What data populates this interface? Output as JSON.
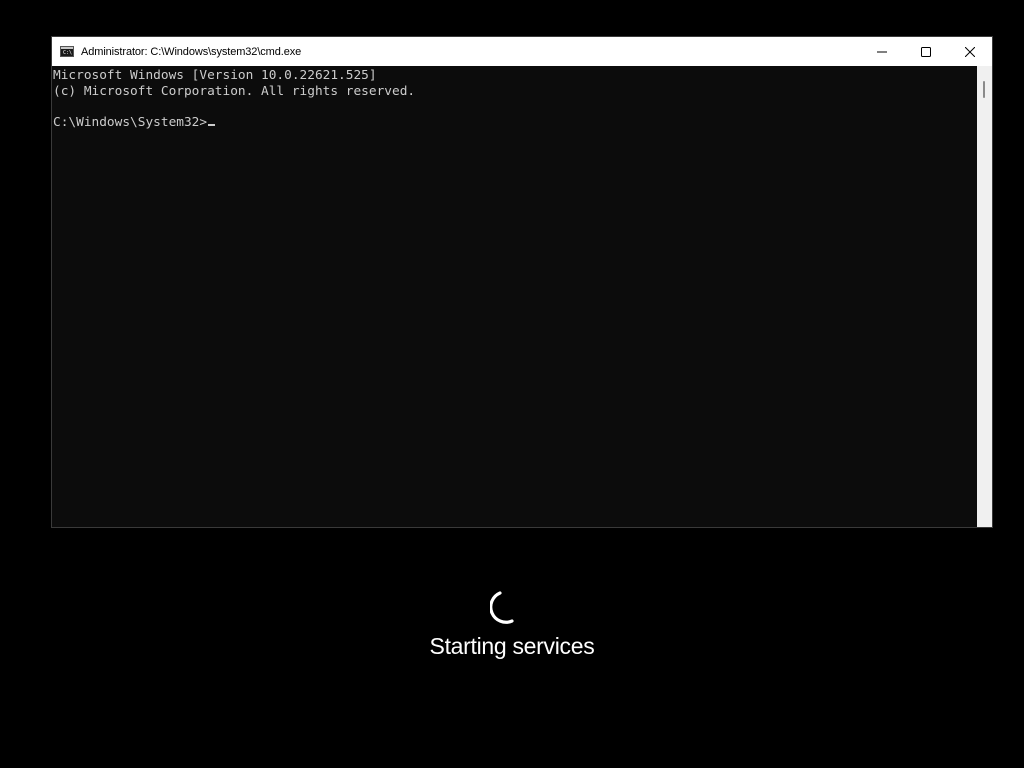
{
  "window": {
    "title": "Administrator: C:\\Windows\\system32\\cmd.exe",
    "icon": "cmd-icon"
  },
  "caption_buttons": {
    "minimize": "minimize-icon",
    "maximize": "maximize-icon",
    "close": "close-icon"
  },
  "console": {
    "lines": [
      "Microsoft Windows [Version 10.0.22621.525]",
      "(c) Microsoft Corporation. All rights reserved.",
      "",
      "C:\\Windows\\System32>"
    ]
  },
  "boot": {
    "status": "Starting services",
    "spinner_icon": "loading-spinner-icon"
  },
  "colors": {
    "console_bg": "#0c0c0c",
    "console_text": "#cccccc",
    "titlebar_bg": "#ffffff",
    "screen_bg": "#000000"
  }
}
